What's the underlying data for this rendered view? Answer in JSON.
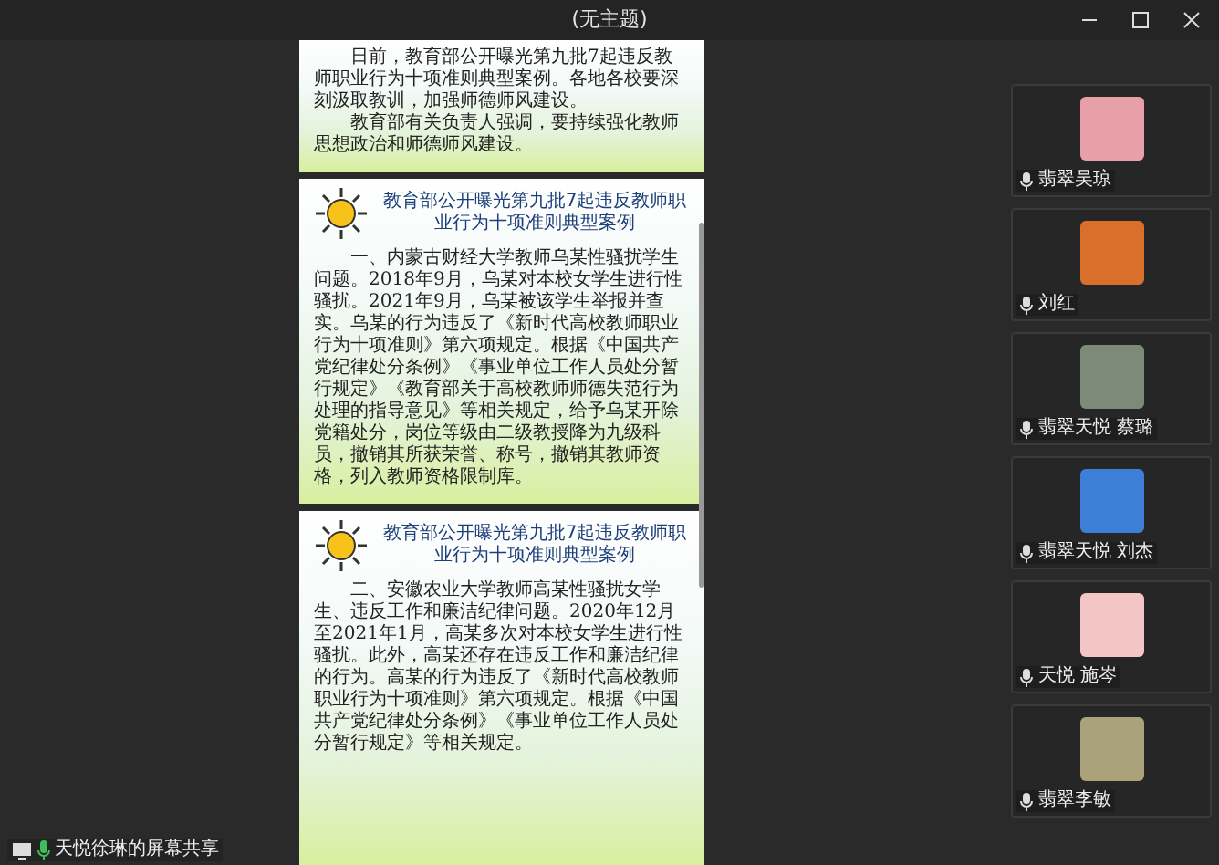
{
  "window": {
    "title": "(无主题)"
  },
  "document": {
    "pages": [
      {
        "paragraphs": [
          "日前，教育部公开曝光第九批7起违反教师职业行为十项准则典型案例。各地各校要深刻汲取教训，加强师德师风建设。",
          "教育部有关负责人强调，要持续强化教师思想政治和师德师风建设。"
        ]
      },
      {
        "heading": "教育部公开曝光第九批7起违反教师职业行为十项准则典型案例",
        "paragraphs": [
          "一、内蒙古财经大学教师乌某性骚扰学生问题。2018年9月，乌某对本校女学生进行性骚扰。2021年9月，乌某被该学生举报并查实。乌某的行为违反了《新时代高校教师职业行为十项准则》第六项规定。根据《中国共产党纪律处分条例》《事业单位工作人员处分暂行规定》《教育部关于高校教师师德失范行为处理的指导意见》等相关规定，给予乌某开除党籍处分，岗位等级由二级教授降为九级科员，撤销其所获荣誉、称号，撤销其教师资格，列入教师资格限制库。"
        ]
      },
      {
        "heading": "教育部公开曝光第九批7起违反教师职业行为十项准则典型案例",
        "paragraphs": [
          "二、安徽农业大学教师高某性骚扰女学生、违反工作和廉洁纪律问题。2020年12月至2021年1月，高某多次对本校女学生进行性骚扰。此外，高某还存在违反工作和廉洁纪律的行为。高某的行为违反了《新时代高校教师职业行为十项准则》第六项规定。根据《中国共产党纪律处分条例》《事业单位工作人员处分暂行规定》等相关规定。"
        ]
      }
    ]
  },
  "participants": [
    {
      "name": "翡翠吴琼"
    },
    {
      "name": "刘红"
    },
    {
      "name": "翡翠天悦 蔡璐"
    },
    {
      "name": "翡翠天悦 刘杰"
    },
    {
      "name": "天悦 施岑"
    },
    {
      "name": "翡翠李敏"
    }
  ],
  "share_label": {
    "text": "天悦徐琳的屏幕共享"
  }
}
